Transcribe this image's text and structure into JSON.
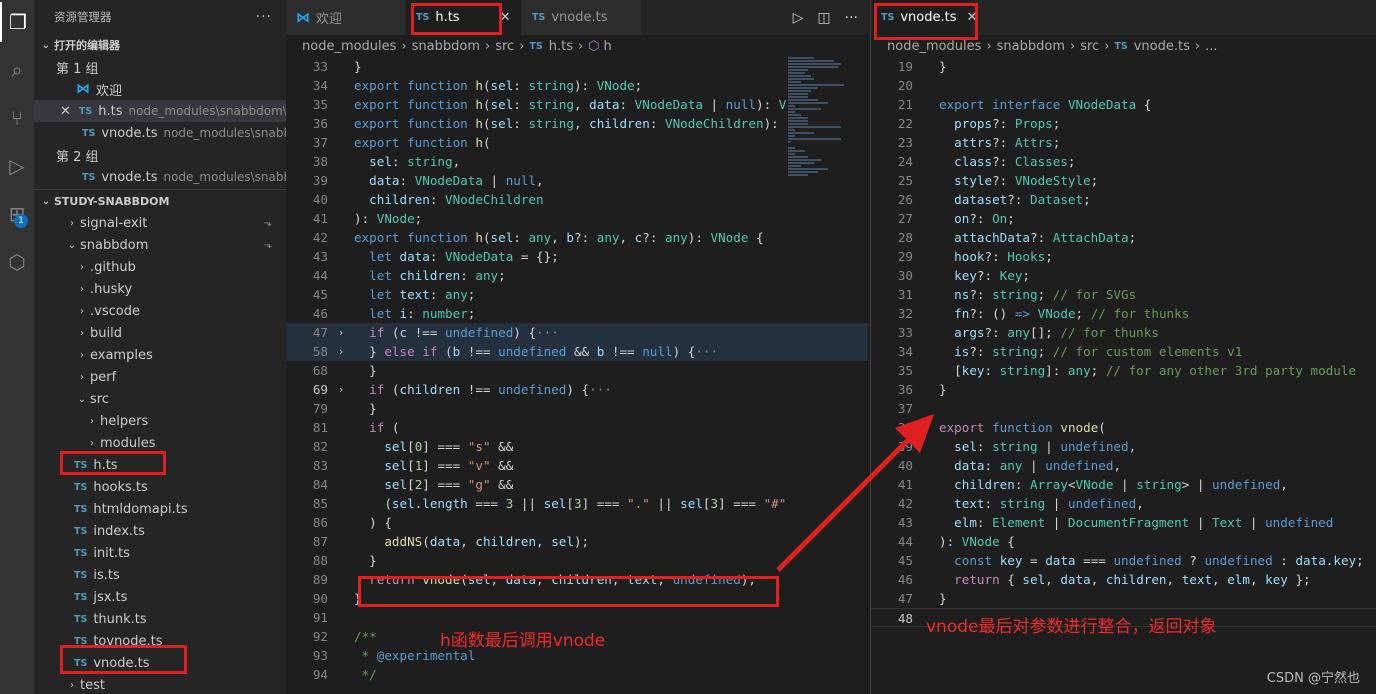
{
  "activity": {
    "badge": "1"
  },
  "sidebar": {
    "title": "资源管理器",
    "open_editors_label": "打开的编辑器",
    "group1_label": "第 1 组",
    "group2_label": "第 2 组",
    "open_editors": [
      {
        "name": "欢迎",
        "path": ""
      },
      {
        "name": "h.ts",
        "path": "node_modules\\snabbdom\\src"
      },
      {
        "name": "vnode.ts",
        "path": "node_modules\\snabbd..."
      },
      {
        "name": "vnode.ts",
        "path": "node_modules\\snabbd..."
      }
    ],
    "project_label": "STUDY-SNABBDOM",
    "tree": [
      {
        "name": "signal-exit",
        "indent": 1,
        "chev": "›"
      },
      {
        "name": "snabbdom",
        "indent": 1,
        "chev": "⌄"
      },
      {
        "name": ".github",
        "indent": 2,
        "chev": "›"
      },
      {
        "name": ".husky",
        "indent": 2,
        "chev": "›"
      },
      {
        "name": ".vscode",
        "indent": 2,
        "chev": "›"
      },
      {
        "name": "build",
        "indent": 2,
        "chev": "›"
      },
      {
        "name": "examples",
        "indent": 2,
        "chev": "›"
      },
      {
        "name": "perf",
        "indent": 2,
        "chev": "›"
      },
      {
        "name": "src",
        "indent": 2,
        "chev": "⌄"
      },
      {
        "name": "helpers",
        "indent": 3,
        "chev": "›"
      },
      {
        "name": "modules",
        "indent": 3,
        "chev": "›"
      }
    ],
    "files": [
      "h.ts",
      "hooks.ts",
      "htmldomapi.ts",
      "index.ts",
      "init.ts",
      "is.ts",
      "jsx.ts",
      "thunk.ts",
      "tovnode.ts",
      "vnode.ts"
    ],
    "last_folder": "test"
  },
  "editor1": {
    "tabs": [
      {
        "label": "欢迎"
      },
      {
        "label": "h.ts"
      },
      {
        "label": "vnode.ts"
      }
    ],
    "breadcrumb": [
      "node_modules",
      "snabbdom",
      "src",
      "h.ts",
      "h"
    ],
    "line_numbers": [
      "33",
      "34",
      "35",
      "36",
      "37",
      "38",
      "39",
      "40",
      "41",
      "42",
      "43",
      "44",
      "45",
      "46",
      "47",
      "58",
      "68",
      "69",
      "79",
      "81",
      "82",
      "83",
      "84",
      "85",
      "86",
      "87",
      "88",
      "89",
      "90",
      "91",
      "92",
      "93",
      "94"
    ]
  },
  "editor2": {
    "tab": "vnode.ts",
    "breadcrumb": [
      "node_modules",
      "snabbdom",
      "src",
      "vnode.ts",
      "..."
    ],
    "line_numbers": [
      "19",
      "20",
      "21",
      "22",
      "23",
      "24",
      "25",
      "26",
      "27",
      "28",
      "29",
      "30",
      "31",
      "32",
      "33",
      "34",
      "35",
      "36",
      "37",
      "38",
      "39",
      "40",
      "41",
      "42",
      "43",
      "44",
      "45",
      "46",
      "47",
      "48"
    ]
  },
  "annotations": {
    "left": "h函数最后调用vnode",
    "right": "vnode最后对参数进行整合，返回对象"
  },
  "watermark": "CSDN @宁然也"
}
